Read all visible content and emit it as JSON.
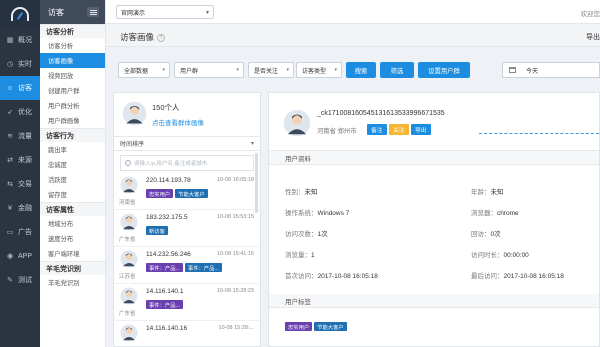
{
  "nav": {
    "items": [
      {
        "icon": "grid-icon",
        "label": "概况"
      },
      {
        "icon": "clock-icon",
        "label": "实时"
      },
      {
        "icon": "user-icon",
        "label": "访客",
        "active": true
      },
      {
        "icon": "rocket-icon",
        "label": "优化"
      },
      {
        "icon": "flow-icon",
        "label": "流量"
      },
      {
        "icon": "source-icon",
        "label": "来源"
      },
      {
        "icon": "trade-icon",
        "label": "交易"
      },
      {
        "icon": "money-icon",
        "label": "金融"
      },
      {
        "icon": "ad-icon",
        "label": "广告"
      },
      {
        "icon": "app-icon",
        "label": "APP"
      },
      {
        "icon": "test-icon",
        "label": "测试"
      }
    ]
  },
  "submenu": {
    "title": "访客",
    "groups": [
      {
        "title": "访客分析",
        "items": [
          {
            "label": "访客分析"
          },
          {
            "label": "访客画像",
            "active": true
          },
          {
            "label": "视频回放"
          },
          {
            "label": "创建用户群"
          },
          {
            "label": "用户群分析"
          },
          {
            "label": "用户群画像"
          }
        ]
      },
      {
        "title": "访客行为",
        "items": [
          {
            "label": "跳出率"
          },
          {
            "label": "忠诚度"
          },
          {
            "label": "活跃度"
          },
          {
            "label": "留存度"
          }
        ]
      },
      {
        "title": "访客属性",
        "items": [
          {
            "label": "地域分布"
          },
          {
            "label": "速度分布"
          },
          {
            "label": "客户端环境"
          }
        ]
      },
      {
        "title": "羊毛党识别",
        "items": [
          {
            "label": "羊毛党识别"
          }
        ]
      }
    ]
  },
  "topbar": {
    "site": "官网演示",
    "welcome": "欢迎您"
  },
  "page": {
    "title": "访客画像",
    "export": "导出"
  },
  "filters": {
    "all_data": "全部数据",
    "user_group": "用户群",
    "follow": "是否关注",
    "visitor_type": "访客类型",
    "search_btn": "搜索",
    "filter_btn": "筛选",
    "set_group_btn": "设置用户群",
    "date": "今天"
  },
  "list": {
    "count": "150个人",
    "group_link": "点击查看群体画像",
    "order": "时间排序",
    "search_placeholder": "请输入ip,用户名,备注或者城市",
    "rows": [
      {
        "ip": "220.114.193.78",
        "time": "10-08 16:05:18",
        "loc": "河南省",
        "tags": [
          {
            "text": "忠实用户",
            "color": "purple"
          },
          {
            "text": "节能大客户",
            "color": "teal"
          }
        ]
      },
      {
        "ip": "183.232.175.5",
        "time": "10-08 15:53:15",
        "loc": "广东省",
        "tags": [
          {
            "text": "新访客",
            "color": "teal"
          }
        ]
      },
      {
        "ip": "114.232.56.246",
        "time": "10-08 15:41:15",
        "loc": "江苏省",
        "tags": [
          {
            "text": "事件：产品...",
            "color": "purple"
          },
          {
            "text": "事件：产品...",
            "color": "teal"
          }
        ]
      },
      {
        "ip": "14.116.140.1",
        "time": "10-08 15:28:23",
        "loc": "广东省",
        "tags": [
          {
            "text": "事件：产品...",
            "color": "purple"
          }
        ]
      },
      {
        "ip": "14.116.140.16",
        "time": "10-08 15:28:...",
        "loc": "",
        "tags": []
      }
    ]
  },
  "profile": {
    "uid": "_ck171008160545131613533996671535",
    "location": "河南省 郑州市",
    "btn_note": "备注",
    "btn_follow": "关注",
    "btn_export": "导出",
    "section_info": "用户资料",
    "fields": {
      "gender_k": "性别：",
      "gender_v": "未知",
      "age_k": "年龄：",
      "age_v": "未知",
      "os_k": "操作系统：",
      "os_v": "Windows 7",
      "browser_k": "浏览器：",
      "browser_v": "chrome",
      "visits_k": "访问次数：",
      "visits_v": "1次",
      "return_k": "回访：",
      "return_v": "0次",
      "pv_k": "浏览量：",
      "pv_v": "1",
      "duration_k": "访问时长：",
      "duration_v": "00:00:00",
      "first_k": "首次访问：",
      "first_v": "2017-10-08 16:05:18",
      "last_k": "最后访问：",
      "last_v": "2017-10-08 16:05:18"
    },
    "section_tags": "用户标签",
    "tags": [
      {
        "text": "忠实用户",
        "color": "purple"
      },
      {
        "text": "节能大客户",
        "color": "teal"
      }
    ]
  }
}
